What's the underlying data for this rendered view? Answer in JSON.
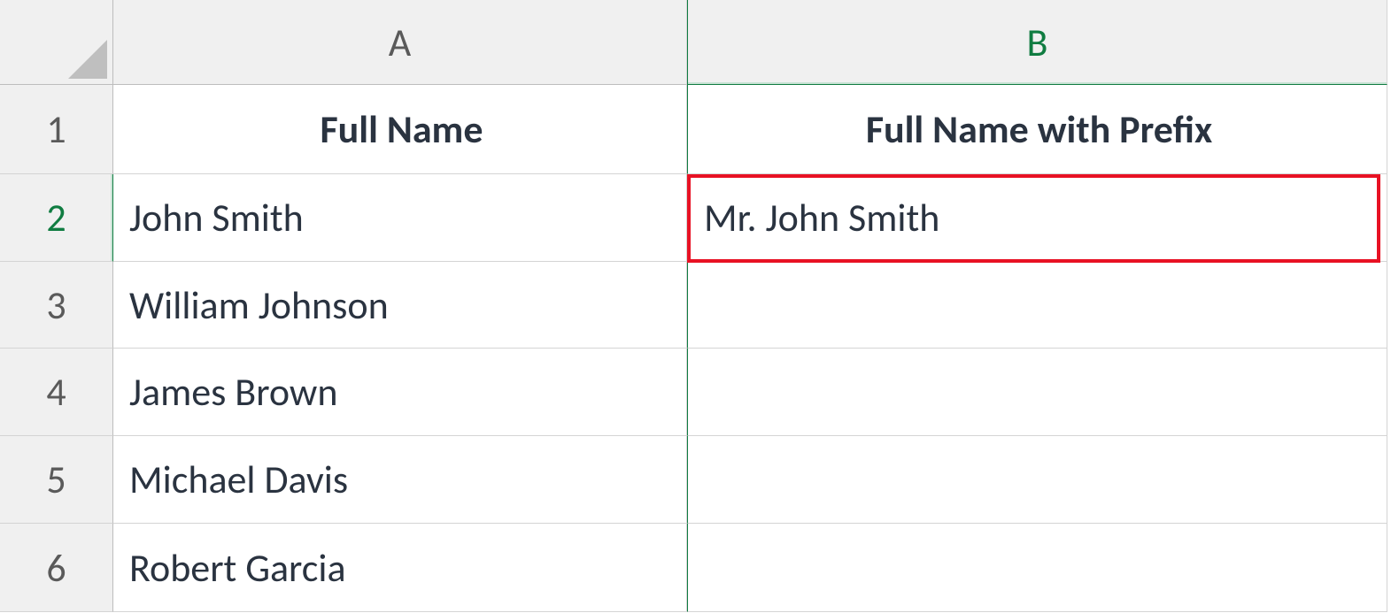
{
  "columns": {
    "A": "A",
    "B": "B"
  },
  "rowNumbers": {
    "r1": "1",
    "r2": "2",
    "r3": "3",
    "r4": "4",
    "r5": "5",
    "r6": "6"
  },
  "headers": {
    "A": "Full Name",
    "B": "Full Name with Prefix"
  },
  "rows": [
    {
      "A": "John Smith",
      "B": "Mr. John Smith"
    },
    {
      "A": "William Johnson",
      "B": ""
    },
    {
      "A": "James Brown",
      "B": ""
    },
    {
      "A": "Michael Davis",
      "B": ""
    },
    {
      "A": "Robert Garcia",
      "B": ""
    }
  ],
  "activeCell": "B2",
  "highlightColor": "#e81123"
}
